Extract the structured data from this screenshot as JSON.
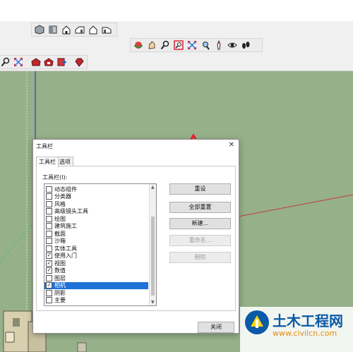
{
  "colors": {
    "accent": "#1e72d8",
    "arrow": "#e8212a",
    "viewport": "#96b08a",
    "watermark_blue": "#0a5aa8",
    "watermark_orange": "#e08b13"
  },
  "toolbars": {
    "views": [
      "iso-view-icon",
      "top-view-icon",
      "front-view-icon",
      "right-view-icon",
      "back-view-icon",
      "left-view-icon"
    ],
    "camera": [
      "orbit-icon",
      "pan-icon",
      "zoom-icon",
      "zoom-window-icon",
      "zoom-extents-icon",
      "previous-view-icon",
      "position-camera-icon",
      "look-around-icon",
      "walk-icon"
    ],
    "left": [
      "zoom-icon",
      "zoom-extents-icon",
      "warehouse-icon",
      "extension-warehouse-icon",
      "share-model-icon",
      "ruby-gem-icon"
    ]
  },
  "dialog": {
    "title": "工具栏",
    "close_glyph": "✕",
    "tabs": [
      "工具栏",
      "选项"
    ],
    "list_label": "工具栏(I):",
    "items": [
      {
        "label": "动态组件",
        "checked": false,
        "selected": false
      },
      {
        "label": "分类器",
        "checked": false,
        "selected": false
      },
      {
        "label": "风格",
        "checked": false,
        "selected": false
      },
      {
        "label": "高级镜头工具",
        "checked": false,
        "selected": false
      },
      {
        "label": "绘图",
        "checked": false,
        "selected": false
      },
      {
        "label": "建筑施工",
        "checked": false,
        "selected": false
      },
      {
        "label": "截面",
        "checked": false,
        "selected": false
      },
      {
        "label": "沙箱",
        "checked": false,
        "selected": false
      },
      {
        "label": "实体工具",
        "checked": false,
        "selected": false
      },
      {
        "label": "使用入门",
        "checked": true,
        "selected": false
      },
      {
        "label": "视图",
        "checked": true,
        "selected": false
      },
      {
        "label": "数值",
        "checked": true,
        "selected": false
      },
      {
        "label": "图层",
        "checked": false,
        "selected": false
      },
      {
        "label": "相机",
        "checked": true,
        "selected": true
      },
      {
        "label": "阴影",
        "checked": false,
        "selected": false
      },
      {
        "label": "主要",
        "checked": false,
        "selected": false
      }
    ],
    "buttons": [
      {
        "label": "重设",
        "enabled": true
      },
      {
        "label": "全部重置",
        "enabled": true
      },
      {
        "label": "新建...",
        "enabled": true
      },
      {
        "label": "重命名...",
        "enabled": false
      },
      {
        "label": "删除",
        "enabled": false
      }
    ],
    "close_button": "关闭"
  },
  "watermark": {
    "name": "土木工程网",
    "url": "www.civilcn.com"
  }
}
